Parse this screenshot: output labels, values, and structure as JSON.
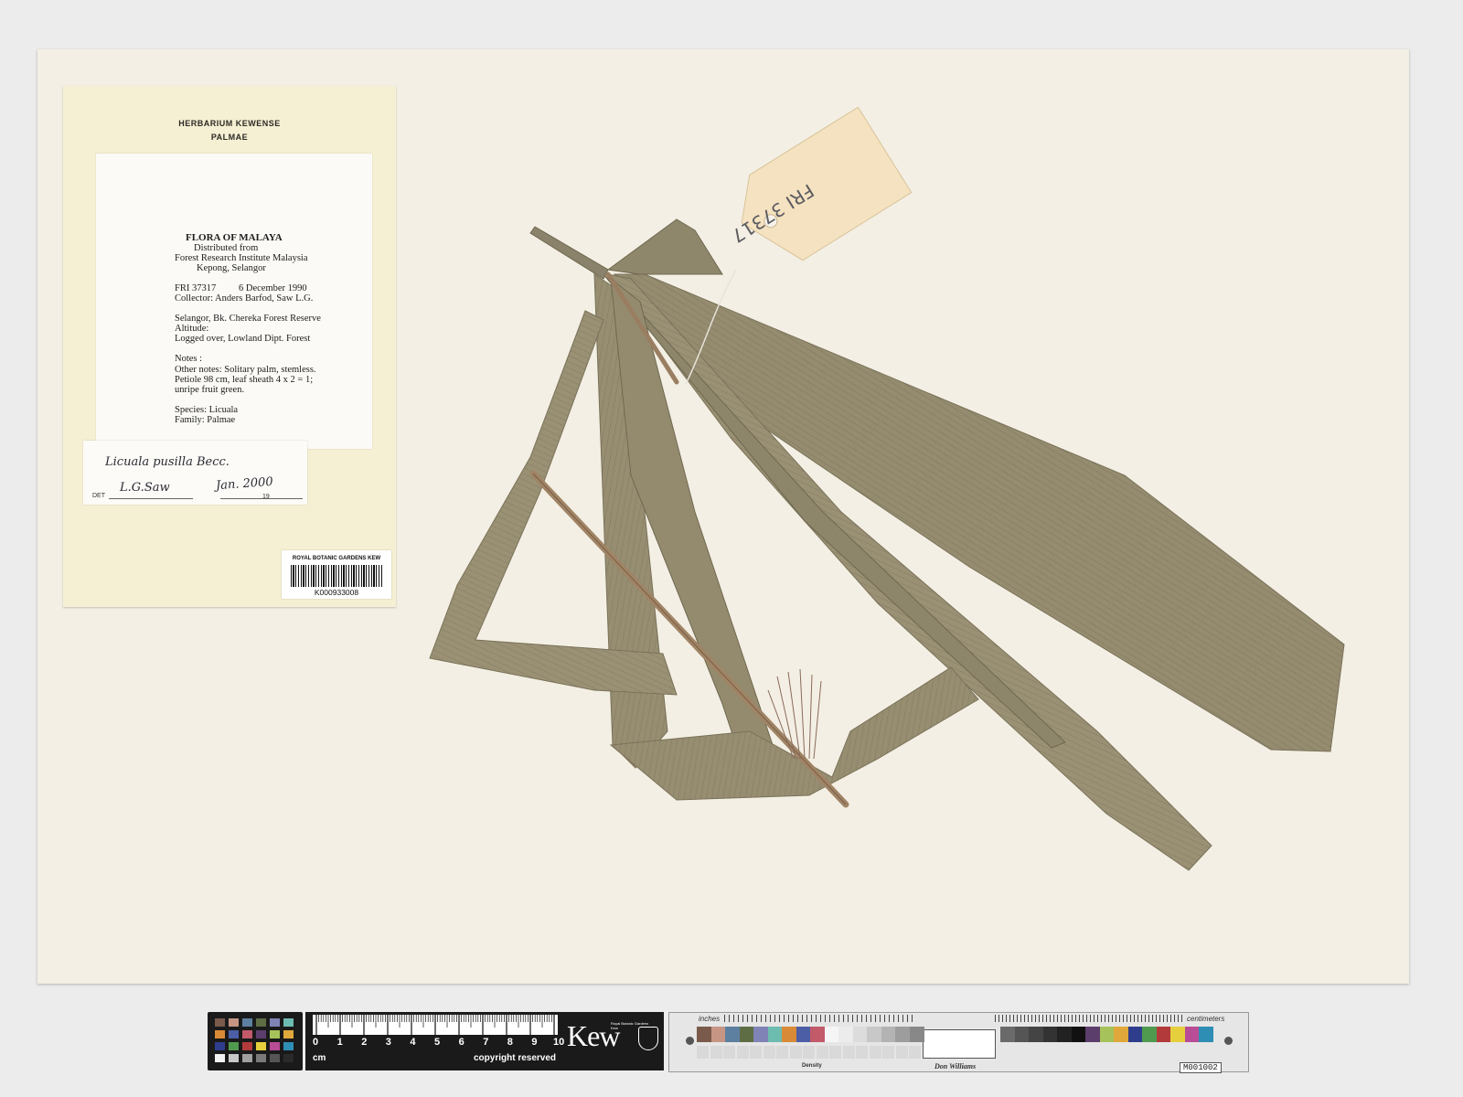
{
  "herbarium": {
    "line1": "HERBARIUM  KEWENSE",
    "line2": "PALMAE"
  },
  "label": {
    "flora": "FLORA OF MALAYA",
    "distributed": "Distributed from",
    "institute": "Forest Research Institute Malaysia",
    "place": "Kepong, Selangor",
    "number": "FRI 37317",
    "date": "6 December 1990",
    "collector": "Collector: Anders Barfod, Saw L.G.",
    "locality": "Selangor, Bk. Chereka Forest Reserve",
    "altitude": "Altitude:",
    "habitat": "Logged over, Lowland Dipt. Forest",
    "notes": "Notes :",
    "other_notes": "Other notes: Solitary palm, stemless.",
    "petiole": "Petiole 98 cm, leaf sheath 4 x 2 = 1;",
    "fruit": "unripe fruit green.",
    "species": "Species: Licuala",
    "family": "Family:  Palmae"
  },
  "determination": {
    "name": "Licuala pusilla Becc.",
    "det_prefix": "DET",
    "determiner": "L.G.Saw",
    "date": "Jan. 2000",
    "year_prefix": "19"
  },
  "barcode": {
    "org": "ROYAL BOTANIC GARDENS KEW",
    "code": "K000933008"
  },
  "tag": {
    "text": "FRI 37317"
  },
  "scale": {
    "numbers": [
      "0",
      "1",
      "2",
      "3",
      "4",
      "5",
      "6",
      "7",
      "8",
      "9",
      "10"
    ],
    "unit": "cm",
    "copyright": "copyright reserved",
    "brand": "Kew",
    "brand_small_1": "Royal Botanic Gardens",
    "brand_small_2": "Kew"
  },
  "target": {
    "inches": "inches",
    "centimeters": "centimeters",
    "density": "Density",
    "maker": "Don Williams",
    "id": "M001002"
  },
  "colors": {
    "sheet": "#f3efe4",
    "leaf": "#948b6f",
    "leaf_dark": "#6f6850",
    "petiole": "#9a7e62",
    "tag": "#f4e2c0"
  },
  "icons": [
    "crest-icon",
    "barcode-icon"
  ]
}
